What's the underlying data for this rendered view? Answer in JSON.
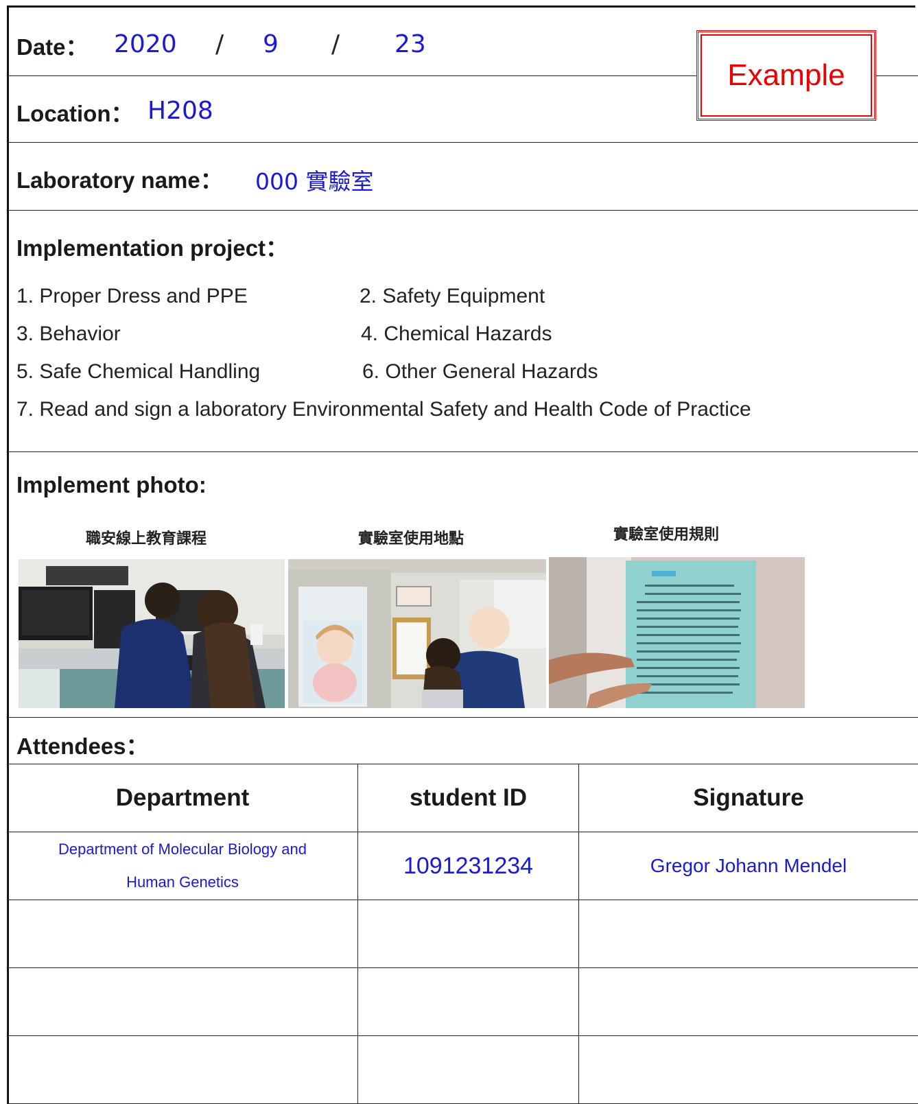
{
  "date": {
    "label": "Date：",
    "year": "2020",
    "sep": "/",
    "month": "9",
    "day": "23"
  },
  "stamp": "Example",
  "location": {
    "label": "Location：",
    "value": "H208"
  },
  "lab": {
    "label": "Laboratory name：",
    "value": "000 實驗室"
  },
  "project": {
    "label": "Implementation project：",
    "items": [
      "1. Proper Dress and PPE",
      "2. Safety Equipment",
      "3. Behavior",
      "4. Chemical Hazards",
      "5. Safe Chemical Handling",
      "6. Other General Hazards",
      "7. Read and sign a laboratory Environmental Safety and Health Code of Practice"
    ]
  },
  "photos": {
    "label": "Implement photo:",
    "captions": [
      "職安線上教育課程",
      "實驗室使用地點",
      "實驗室使用規則"
    ]
  },
  "attendees": {
    "label": "Attendees：",
    "headers": [
      "Department",
      "student ID",
      "Signature"
    ],
    "rows": [
      {
        "department": "Department of Molecular Biology and Human Genetics",
        "student_id": "1091231234",
        "signature": "Gregor Johann Mendel"
      }
    ]
  },
  "colors": {
    "handwriting": "#1a1ad6",
    "stamp": "#e00000"
  }
}
